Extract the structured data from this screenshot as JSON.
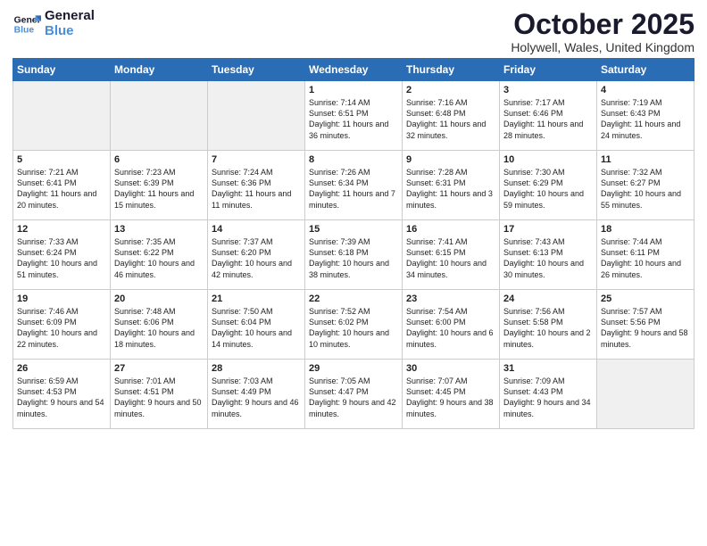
{
  "logo": {
    "line1": "General",
    "line2": "Blue"
  },
  "title": "October 2025",
  "location": "Holywell, Wales, United Kingdom",
  "days_header": [
    "Sunday",
    "Monday",
    "Tuesday",
    "Wednesday",
    "Thursday",
    "Friday",
    "Saturday"
  ],
  "weeks": [
    [
      {
        "day": "",
        "content": "",
        "gray": true
      },
      {
        "day": "",
        "content": "",
        "gray": true
      },
      {
        "day": "",
        "content": "",
        "gray": true
      },
      {
        "day": "1",
        "content": "Sunrise: 7:14 AM\nSunset: 6:51 PM\nDaylight: 11 hours\nand 36 minutes.",
        "gray": false
      },
      {
        "day": "2",
        "content": "Sunrise: 7:16 AM\nSunset: 6:48 PM\nDaylight: 11 hours\nand 32 minutes.",
        "gray": false
      },
      {
        "day": "3",
        "content": "Sunrise: 7:17 AM\nSunset: 6:46 PM\nDaylight: 11 hours\nand 28 minutes.",
        "gray": false
      },
      {
        "day": "4",
        "content": "Sunrise: 7:19 AM\nSunset: 6:43 PM\nDaylight: 11 hours\nand 24 minutes.",
        "gray": false
      }
    ],
    [
      {
        "day": "5",
        "content": "Sunrise: 7:21 AM\nSunset: 6:41 PM\nDaylight: 11 hours\nand 20 minutes.",
        "gray": false
      },
      {
        "day": "6",
        "content": "Sunrise: 7:23 AM\nSunset: 6:39 PM\nDaylight: 11 hours\nand 15 minutes.",
        "gray": false
      },
      {
        "day": "7",
        "content": "Sunrise: 7:24 AM\nSunset: 6:36 PM\nDaylight: 11 hours\nand 11 minutes.",
        "gray": false
      },
      {
        "day": "8",
        "content": "Sunrise: 7:26 AM\nSunset: 6:34 PM\nDaylight: 11 hours\nand 7 minutes.",
        "gray": false
      },
      {
        "day": "9",
        "content": "Sunrise: 7:28 AM\nSunset: 6:31 PM\nDaylight: 11 hours\nand 3 minutes.",
        "gray": false
      },
      {
        "day": "10",
        "content": "Sunrise: 7:30 AM\nSunset: 6:29 PM\nDaylight: 10 hours\nand 59 minutes.",
        "gray": false
      },
      {
        "day": "11",
        "content": "Sunrise: 7:32 AM\nSunset: 6:27 PM\nDaylight: 10 hours\nand 55 minutes.",
        "gray": false
      }
    ],
    [
      {
        "day": "12",
        "content": "Sunrise: 7:33 AM\nSunset: 6:24 PM\nDaylight: 10 hours\nand 51 minutes.",
        "gray": false
      },
      {
        "day": "13",
        "content": "Sunrise: 7:35 AM\nSunset: 6:22 PM\nDaylight: 10 hours\nand 46 minutes.",
        "gray": false
      },
      {
        "day": "14",
        "content": "Sunrise: 7:37 AM\nSunset: 6:20 PM\nDaylight: 10 hours\nand 42 minutes.",
        "gray": false
      },
      {
        "day": "15",
        "content": "Sunrise: 7:39 AM\nSunset: 6:18 PM\nDaylight: 10 hours\nand 38 minutes.",
        "gray": false
      },
      {
        "day": "16",
        "content": "Sunrise: 7:41 AM\nSunset: 6:15 PM\nDaylight: 10 hours\nand 34 minutes.",
        "gray": false
      },
      {
        "day": "17",
        "content": "Sunrise: 7:43 AM\nSunset: 6:13 PM\nDaylight: 10 hours\nand 30 minutes.",
        "gray": false
      },
      {
        "day": "18",
        "content": "Sunrise: 7:44 AM\nSunset: 6:11 PM\nDaylight: 10 hours\nand 26 minutes.",
        "gray": false
      }
    ],
    [
      {
        "day": "19",
        "content": "Sunrise: 7:46 AM\nSunset: 6:09 PM\nDaylight: 10 hours\nand 22 minutes.",
        "gray": false
      },
      {
        "day": "20",
        "content": "Sunrise: 7:48 AM\nSunset: 6:06 PM\nDaylight: 10 hours\nand 18 minutes.",
        "gray": false
      },
      {
        "day": "21",
        "content": "Sunrise: 7:50 AM\nSunset: 6:04 PM\nDaylight: 10 hours\nand 14 minutes.",
        "gray": false
      },
      {
        "day": "22",
        "content": "Sunrise: 7:52 AM\nSunset: 6:02 PM\nDaylight: 10 hours\nand 10 minutes.",
        "gray": false
      },
      {
        "day": "23",
        "content": "Sunrise: 7:54 AM\nSunset: 6:00 PM\nDaylight: 10 hours\nand 6 minutes.",
        "gray": false
      },
      {
        "day": "24",
        "content": "Sunrise: 7:56 AM\nSunset: 5:58 PM\nDaylight: 10 hours\nand 2 minutes.",
        "gray": false
      },
      {
        "day": "25",
        "content": "Sunrise: 7:57 AM\nSunset: 5:56 PM\nDaylight: 9 hours\nand 58 minutes.",
        "gray": false
      }
    ],
    [
      {
        "day": "26",
        "content": "Sunrise: 6:59 AM\nSunset: 4:53 PM\nDaylight: 9 hours\nand 54 minutes.",
        "gray": false
      },
      {
        "day": "27",
        "content": "Sunrise: 7:01 AM\nSunset: 4:51 PM\nDaylight: 9 hours\nand 50 minutes.",
        "gray": false
      },
      {
        "day": "28",
        "content": "Sunrise: 7:03 AM\nSunset: 4:49 PM\nDaylight: 9 hours\nand 46 minutes.",
        "gray": false
      },
      {
        "day": "29",
        "content": "Sunrise: 7:05 AM\nSunset: 4:47 PM\nDaylight: 9 hours\nand 42 minutes.",
        "gray": false
      },
      {
        "day": "30",
        "content": "Sunrise: 7:07 AM\nSunset: 4:45 PM\nDaylight: 9 hours\nand 38 minutes.",
        "gray": false
      },
      {
        "day": "31",
        "content": "Sunrise: 7:09 AM\nSunset: 4:43 PM\nDaylight: 9 hours\nand 34 minutes.",
        "gray": false
      },
      {
        "day": "",
        "content": "",
        "gray": true
      }
    ]
  ]
}
